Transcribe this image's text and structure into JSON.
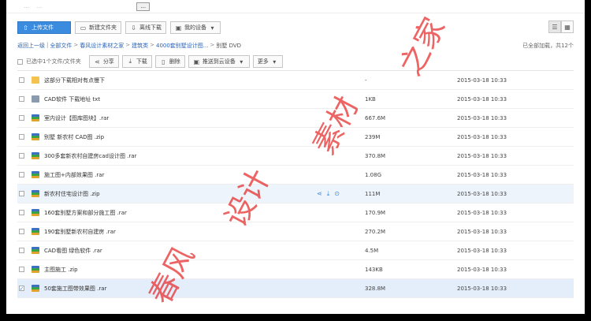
{
  "topstrip": {
    "text_left": "...",
    "text_mid": "...",
    "button": "..."
  },
  "toolbar": {
    "upload": "上传文件",
    "new_folder": "新建文件夹",
    "offline": "离线下载",
    "device": "我的设备"
  },
  "breadcrumb": {
    "items": [
      "返回上一级",
      "全部文件",
      "春风设计素材之家",
      "建筑类",
      "4000套别墅设计图...",
      "别墅 DVD"
    ],
    "loaded": "已全部加载，共12个"
  },
  "actions": {
    "selected": "已选中1个文件/文件夹",
    "share": "分享",
    "download": "下载",
    "delete": "删除",
    "push": "推送到云设备",
    "more": "更多"
  },
  "files": [
    {
      "name": "这部分下载相对有点慢下",
      "type": "folder",
      "size": "-",
      "date": "2015-03-18 10:33"
    },
    {
      "name": "CAD软件 下载地址 txt",
      "type": "txt",
      "size": "1KB",
      "date": "2015-03-18 10:33"
    },
    {
      "name": "室内设计【图库图块】.rar",
      "type": "zip",
      "size": "667.6M",
      "date": "2015-03-18 10:33"
    },
    {
      "name": "别墅 新农村 CAD图 .zip",
      "type": "zip",
      "size": "239M",
      "date": "2015-03-18 10:33"
    },
    {
      "name": "300多套新农村自建房cad设计图 .rar",
      "type": "zip",
      "size": "370.8M",
      "date": "2015-03-18 10:33"
    },
    {
      "name": "施工图+内部效果图 .rar",
      "type": "zip",
      "size": "1.08G",
      "date": "2015-03-18 10:33"
    },
    {
      "name": "新农村住宅设计图 .zip",
      "type": "zip",
      "size": "111M",
      "date": "2015-03-18 10:33"
    },
    {
      "name": "160套别墅方案和部分施工图 .rar",
      "type": "zip",
      "size": "170.9M",
      "date": "2015-03-18 10:33"
    },
    {
      "name": "190套别墅新农村自建房 .rar",
      "type": "zip",
      "size": "270.2M",
      "date": "2015-03-18 10:33"
    },
    {
      "name": "CAD看图 绿色软件 .rar",
      "type": "zip",
      "size": "4.5M",
      "date": "2015-03-18 10:33"
    },
    {
      "name": "主图施工 .zip",
      "type": "zip",
      "size": "143KB",
      "date": "2015-03-18 10:33"
    },
    {
      "name": "50套施工图带效果图 .rar",
      "type": "zip",
      "size": "328.8M",
      "date": "2015-03-18 10:33"
    }
  ],
  "watermark": {
    "chars": [
      "春风",
      "设计",
      "素材",
      "之家"
    ],
    "color": "#e42828"
  },
  "accent": "#3b8cde"
}
